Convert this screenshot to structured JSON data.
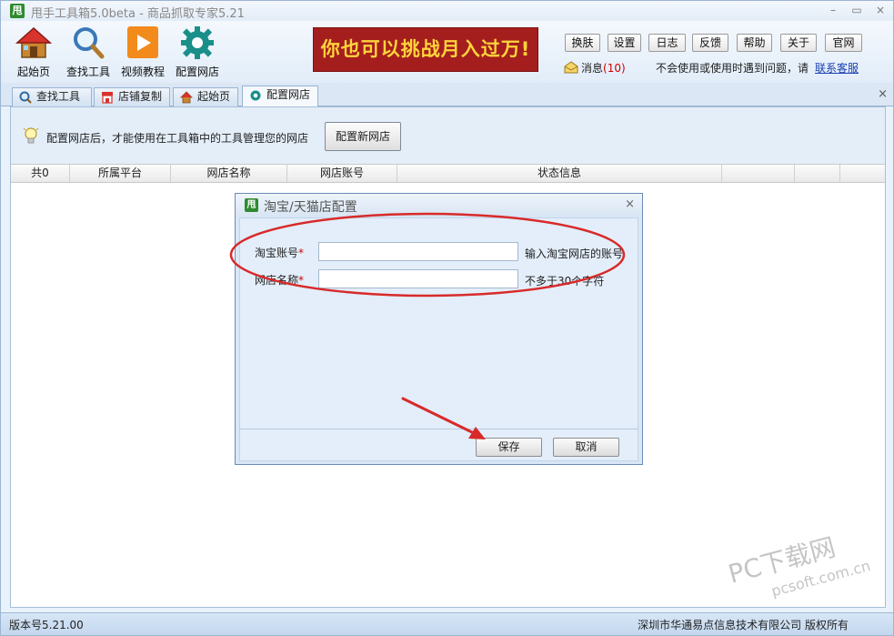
{
  "window": {
    "logo_char": "甩",
    "title": "甩手工具箱5.0beta - 商品抓取专家5.21",
    "controls": {
      "minimize": "–",
      "maximize": "▭",
      "close": "×"
    }
  },
  "toolbar": {
    "tools": [
      {
        "label": "起始页",
        "icon": "home-icon"
      },
      {
        "label": "查找工具",
        "icon": "search-icon"
      },
      {
        "label": "视频教程",
        "icon": "play-icon"
      },
      {
        "label": "配置网店",
        "icon": "gear-icon"
      }
    ],
    "banner": "你也可以挑战月入过万!",
    "buttons": [
      "换肤",
      "设置",
      "日志",
      "反馈",
      "帮助",
      "关于",
      "官网"
    ],
    "message_label": "消息",
    "message_count": "(10)",
    "help_text": "不会使用或使用时遇到问题，请",
    "help_link": "联系客服"
  },
  "tabs": [
    {
      "label": "查找工具",
      "icon": "search-icon"
    },
    {
      "label": "店铺复制",
      "icon": "store-icon"
    },
    {
      "label": "起始页",
      "icon": "home-icon"
    },
    {
      "label": "配置网店",
      "icon": "gear-icon",
      "active": true
    }
  ],
  "tabs_close_all": "×",
  "panel": {
    "info_text": "配置网店后，才能使用在工具箱中的工具管理您的网店",
    "config_new_button": "配置新网店",
    "columns": [
      "共0",
      "所属平台",
      "网店名称",
      "网店账号",
      "状态信息",
      "",
      ""
    ]
  },
  "dialog": {
    "logo_char": "甩",
    "title": "淘宝/天猫店配置",
    "close": "×",
    "fields": [
      {
        "label": "淘宝账号",
        "required": "*",
        "value": "",
        "hint": "输入淘宝网店的账号"
      },
      {
        "label": "网店名称",
        "required": "*",
        "value": "",
        "hint": "不多于30个字符"
      }
    ],
    "save_button": "保存",
    "cancel_button": "取消"
  },
  "statusbar": {
    "version": "版本号5.21.00",
    "copyright": "深圳市华通易点信息技术有限公司 版权所有"
  },
  "watermark": {
    "main": "PC下载网",
    "sub": "pcsoft.com.cn"
  },
  "colors": {
    "accent": "#d82a2a",
    "banner_bg": "#a51e1e",
    "banner_text": "#ffd43b",
    "link": "#1a3fb0"
  }
}
